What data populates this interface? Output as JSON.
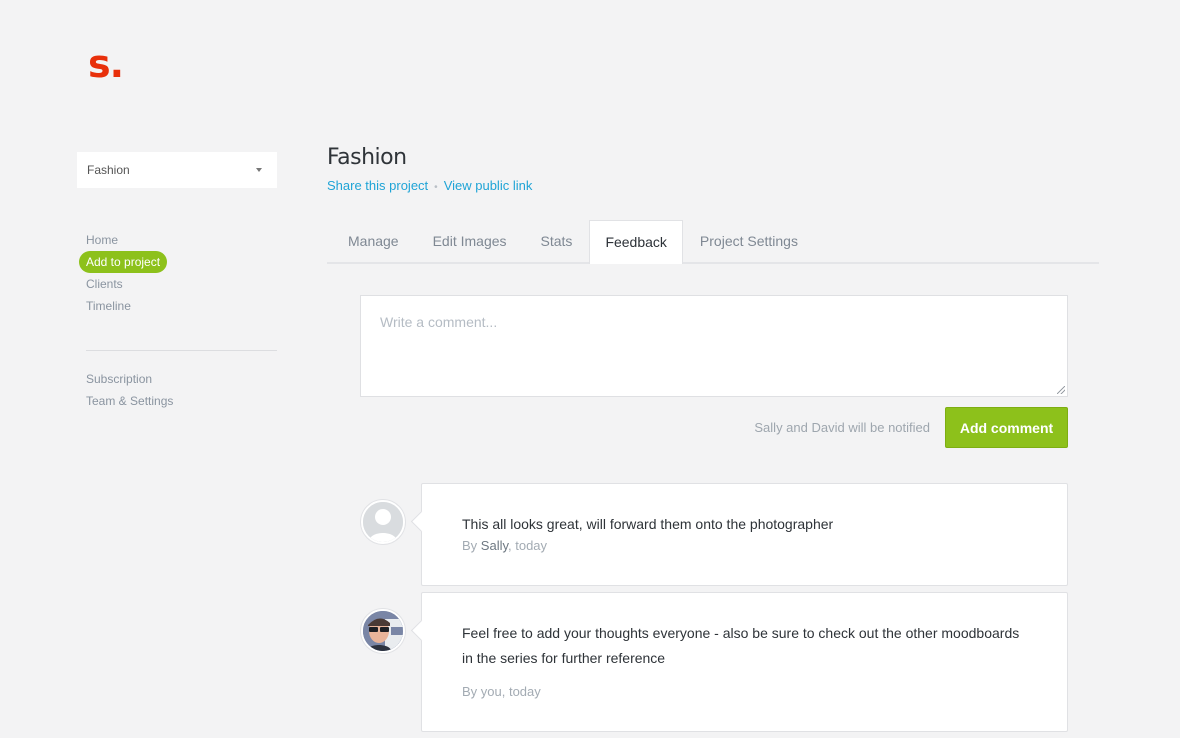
{
  "brand": {
    "logo": "s."
  },
  "sidebar": {
    "project_select": "Fashion",
    "nav": [
      {
        "label": "Home",
        "active": false
      },
      {
        "label": "Add to project",
        "active": true
      },
      {
        "label": "Clients",
        "active": false
      },
      {
        "label": "Timeline",
        "active": false
      }
    ],
    "nav_secondary": [
      {
        "label": "Subscription"
      },
      {
        "label": "Team & Settings"
      }
    ]
  },
  "header": {
    "title": "Fashion",
    "share_link": "Share this project",
    "separator": "•",
    "public_link": "View public link"
  },
  "tabs": [
    {
      "label": "Manage",
      "active": false
    },
    {
      "label": "Edit Images",
      "active": false
    },
    {
      "label": "Stats",
      "active": false
    },
    {
      "label": "Feedback",
      "active": true
    },
    {
      "label": "Project Settings",
      "active": false
    }
  ],
  "composer": {
    "placeholder": "Write a comment...",
    "value": "",
    "notify_text": "Sally and David will be notified",
    "submit_label": "Add comment"
  },
  "comments": [
    {
      "text": "This all looks great, will forward them onto the photographer",
      "by": "By ",
      "author": "Sally",
      "when": ", today",
      "avatar": "default-user-avatar"
    },
    {
      "text": "Feel free to add your thoughts everyone - also be sure to check out the other moodboards in the series for further reference",
      "by": "By you, today",
      "author": "",
      "when": "",
      "avatar": "user-photo-avatar"
    }
  ],
  "colors": {
    "brand": "#e8300b",
    "accent_green": "#8dc11b",
    "link_blue": "#1fa4d6",
    "background": "#f3f3f4"
  }
}
